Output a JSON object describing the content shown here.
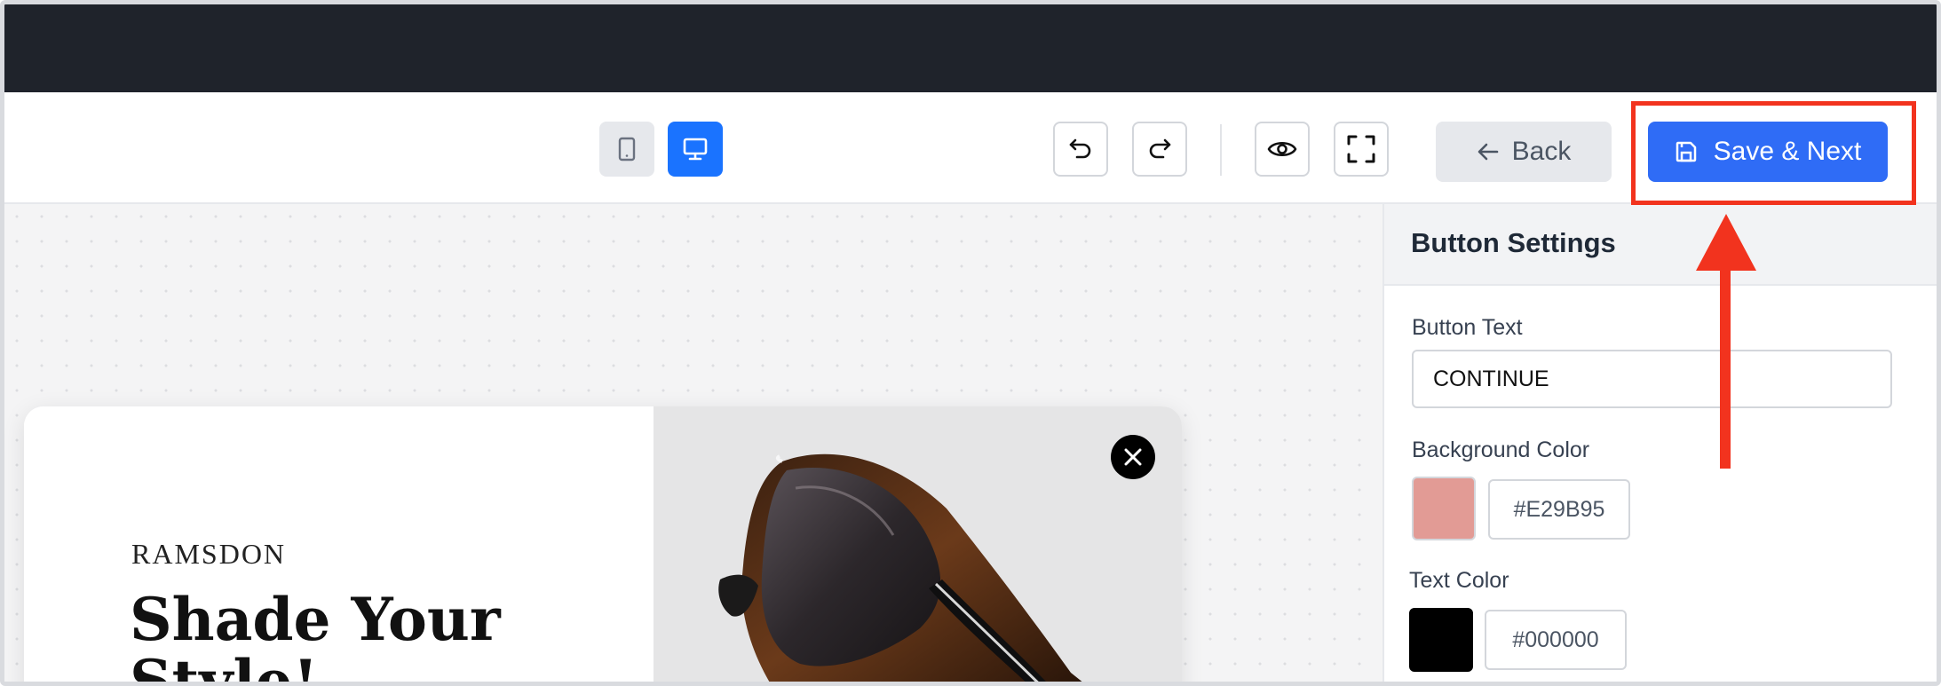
{
  "toolbar": {
    "back_label": "Back",
    "save_label": "Save & Next"
  },
  "preview": {
    "brand": "RAMSDON",
    "headline": "Shade Your Style!"
  },
  "settings": {
    "title": "Button Settings",
    "button_text_label": "Button Text",
    "button_text_value": "CONTINUE",
    "background_color_label": "Background Color",
    "background_color_value": "#E29B95",
    "text_color_label": "Text Color",
    "text_color_value": "#000000"
  },
  "colors": {
    "accent": "#2f6cf6",
    "annotation": "#f2331e",
    "background_swatch": "#E29B95",
    "text_swatch": "#000000"
  }
}
